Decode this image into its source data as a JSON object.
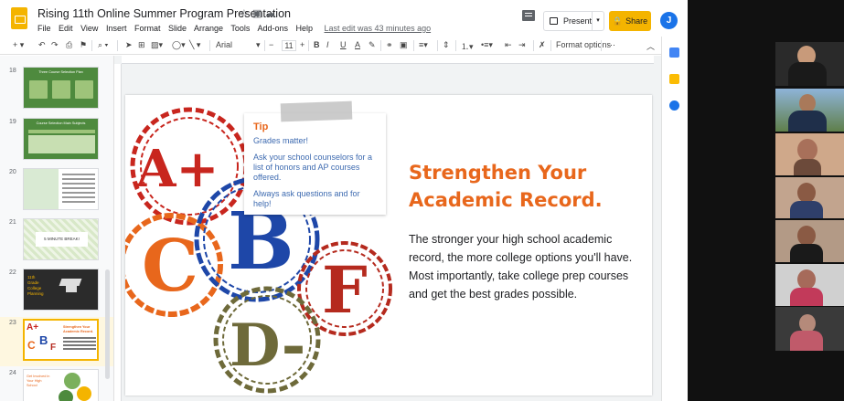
{
  "app": {
    "doc_title": "Rising 11th Online Summer Program Presentation",
    "menu": [
      "File",
      "Edit",
      "View",
      "Insert",
      "Format",
      "Slide",
      "Arrange",
      "Tools",
      "Add-ons",
      "Help"
    ],
    "last_edit": "Last edit was 43 minutes ago",
    "present_label": "Present",
    "share_label": "Share",
    "avatar_letter": "J",
    "accent_color": "#f4b400"
  },
  "toolbar": {
    "font_name": "Arial",
    "font_size": "11",
    "format_options": "Format options",
    "bold": "B",
    "italic": "I",
    "underline": "U",
    "text_color": "A"
  },
  "filmstrip": {
    "slides": [
      {
        "num": "18",
        "title": "Three Course Selection Plan",
        "theme": "green"
      },
      {
        "num": "19",
        "title": "Course Selection Main Subjects",
        "theme": "green"
      },
      {
        "num": "20",
        "title": "",
        "theme": "lightgreen"
      },
      {
        "num": "21",
        "title": "5 MINUTE BREAK!",
        "theme": "pattern"
      },
      {
        "num": "22",
        "title": "11th Grade College Planning",
        "theme": "dark"
      },
      {
        "num": "23",
        "title": "Strengthen Your Academic Record.",
        "theme": "grades",
        "selected": true
      },
      {
        "num": "24",
        "title": "Get Involved in Your High School",
        "theme": "circles"
      }
    ]
  },
  "slide": {
    "tip_title": "Tip",
    "tip_lines": [
      "Grades matter!",
      "Ask your school counselors for a list of honors and AP courses offered.",
      "Always ask questions and for help!"
    ],
    "title": "Strengthen Your Academic Record.",
    "body": "The stronger your high school academic record, the more college options you'll have. Most importantly, take college prep courses and get the best grades possible.",
    "stamps": [
      {
        "letter": "A+",
        "color": "#c8261e"
      },
      {
        "letter": "B",
        "color": "#1e47a8"
      },
      {
        "letter": "C",
        "color": "#e8671c"
      },
      {
        "letter": "D-",
        "color": "#6e6a3a"
      },
      {
        "letter": "F",
        "color": "#b52a1e"
      }
    ],
    "title_color": "#e8671c",
    "tip_color": "#3d6ab0"
  },
  "video": {
    "participants": [
      {
        "id": "p1",
        "bg": "#2a2a2a"
      },
      {
        "id": "p2",
        "bg": "#6d8fb5"
      },
      {
        "id": "p3",
        "bg": "#c9a68a"
      },
      {
        "id": "p4",
        "bg": "#b99a86"
      },
      {
        "id": "p5",
        "bg": "#a98d78"
      },
      {
        "id": "p6",
        "bg": "#c0c0c0"
      },
      {
        "id": "p7",
        "bg": "#3a3a3a"
      }
    ]
  }
}
